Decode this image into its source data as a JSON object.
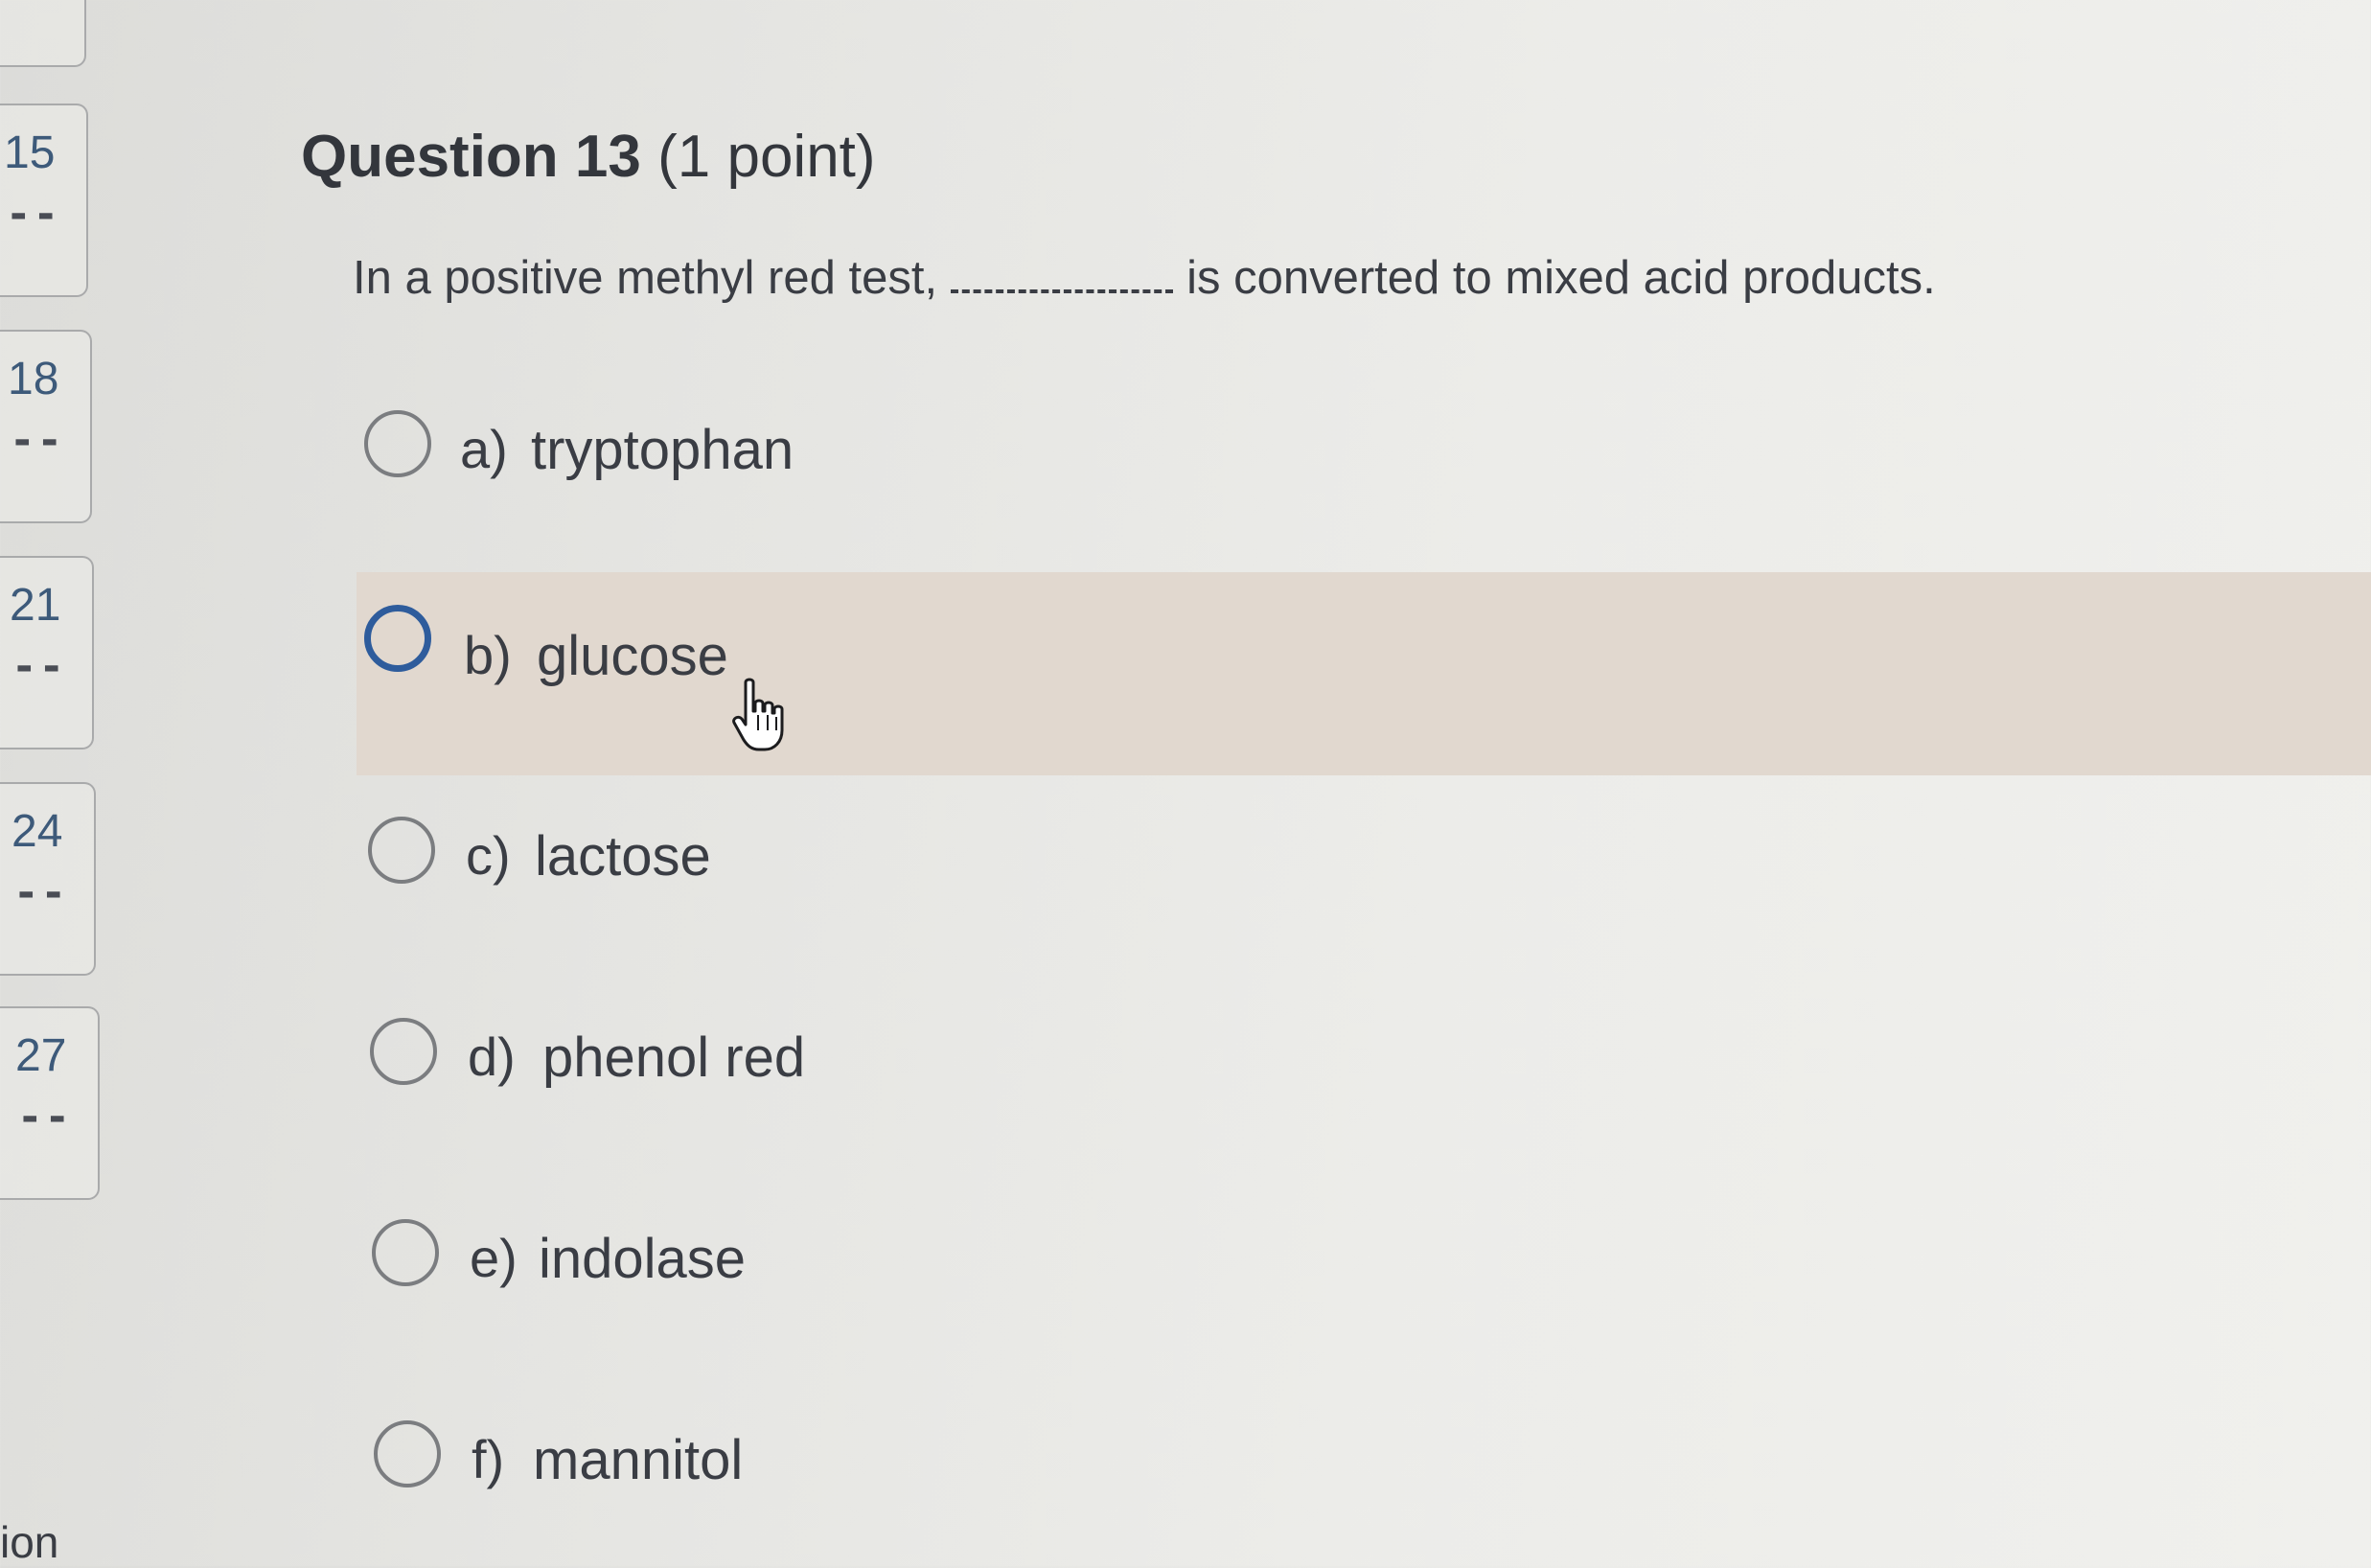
{
  "navigator": {
    "items": [
      {
        "number": "15",
        "status": "--"
      },
      {
        "number": "18",
        "status": "--"
      },
      {
        "number": "21",
        "status": "--"
      },
      {
        "number": "24",
        "status": "--"
      },
      {
        "number": "27",
        "status": "--"
      }
    ],
    "footer_text": "ion",
    "top_icon": "check-icon"
  },
  "question": {
    "title": "Question 13",
    "points": "(1 point)",
    "stem_before": "In a positive methyl red test,",
    "stem_after": "is converted to mixed acid products.",
    "options": [
      {
        "letter": "a)",
        "text": "tryptophan"
      },
      {
        "letter": "b)",
        "text": "glucose"
      },
      {
        "letter": "c)",
        "text": "lactose"
      },
      {
        "letter": "d)",
        "text": "phenol red"
      },
      {
        "letter": "e)",
        "text": "indolase"
      },
      {
        "letter": "f)",
        "text": "mannitol"
      }
    ]
  },
  "colors": {
    "hover_row": "#e1d8cf",
    "radio_focus": "#2e5c9c",
    "nav_number": "#3d5a7a"
  },
  "cursor_icon": "pointer-hand-icon"
}
